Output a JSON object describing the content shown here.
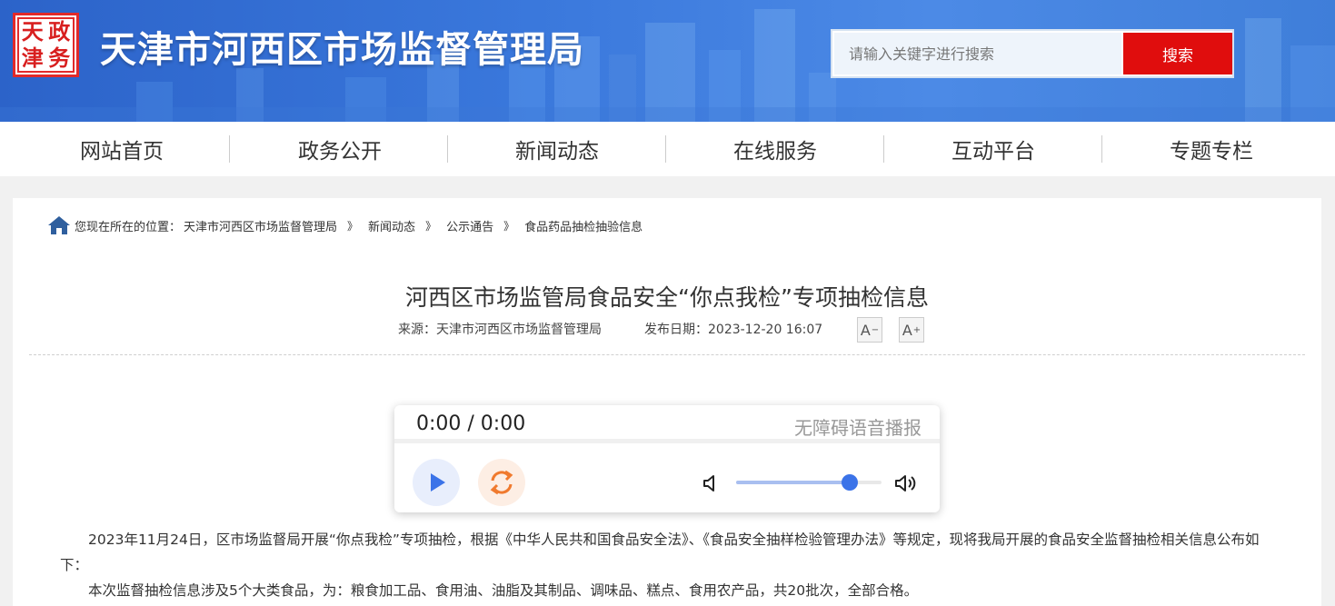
{
  "header": {
    "seal_chars": [
      "政",
      "天",
      "务",
      "津"
    ],
    "site_title": "天津市河西区市场监督管理局",
    "search": {
      "placeholder": "请输入关键字进行搜索",
      "button_label": "搜索"
    }
  },
  "nav": {
    "items": [
      {
        "label": "网站首页"
      },
      {
        "label": "政务公开"
      },
      {
        "label": "新闻动态"
      },
      {
        "label": "在线服务"
      },
      {
        "label": "互动平台"
      },
      {
        "label": "专题专栏"
      }
    ]
  },
  "breadcrumb": {
    "prefix": "您现在所在的位置：",
    "items": [
      "天津市河西区市场监督管理局",
      "新闻动态",
      "公示通告",
      "食品药品抽检抽验信息"
    ],
    "separator": "》"
  },
  "article": {
    "title": "河西区市场监管局食品安全“你点我检”专项抽检信息",
    "source": "来源：天津市河西区市场监督管理局",
    "date": "发布日期：2023-12-20 16:07",
    "font_decrease": "A",
    "font_increase": "A",
    "font_minus": "−",
    "font_plus": "+",
    "paragraphs": [
      "2023年11月24日，区市场监督局开展“你点我检”专项抽检，根据《中华人民共和国食品安全法》、《食品安全抽样检验管理办法》等规定，现将我局开展的食品安全监督抽检相关信息公布如下：",
      "本次监督抽检信息涉及5个大类食品，为：粮食加工品、食用油、油脂及其制品、调味品、糕点、食用农产品，共20批次，全部合格。"
    ]
  },
  "player": {
    "time": "0:00 / 0:00",
    "label": "无障碍语音播报",
    "volume": 0.78
  },
  "colors": {
    "search_button": "#e00d0d",
    "play_accent": "#3b73e8",
    "replay_accent": "#f07a2e"
  }
}
